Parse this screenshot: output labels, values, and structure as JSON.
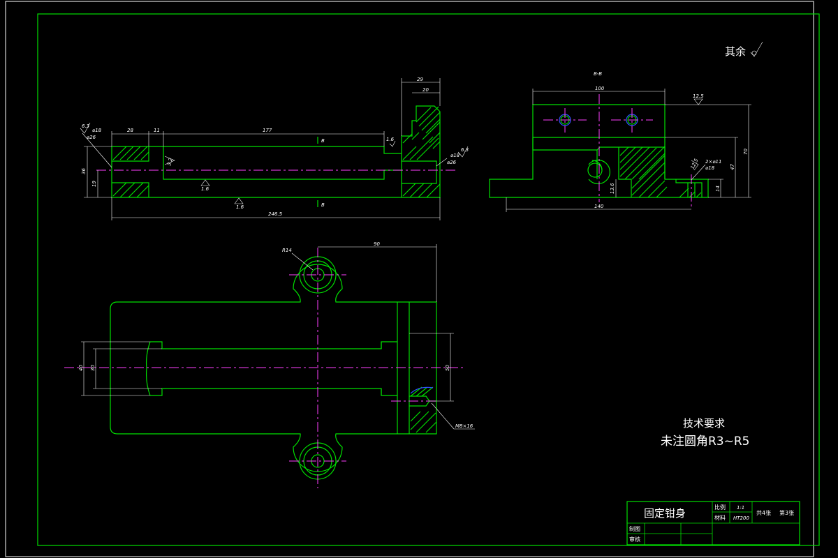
{
  "drawing": {
    "roughness_note": "其余",
    "section_label": "B-B",
    "tech_requirements": {
      "title": "技术要求",
      "note": "未注圆角R3~R5"
    },
    "title_block": {
      "part_name": "固定钳身",
      "scale_label": "比例",
      "scale_value": "1:1",
      "material_label": "材料",
      "material_value": "HT200",
      "sheet_total": "共4张",
      "sheet_number": "第3张",
      "drawn_label": "制图",
      "checked_label": "审核"
    },
    "front_view_dims": {
      "d29": "29",
      "d20": "20",
      "d177": "177",
      "d28": "28",
      "d11": "11",
      "d36": "36",
      "d19": "19",
      "d2465": "246.5",
      "phi18_left": "⌀18",
      "fit_left": "⌀26",
      "phi18_right": "⌀18",
      "fit_right": "⌀26",
      "ra63_left": "6.3",
      "ra63_right": "6.3",
      "ra16_a": "1.6",
      "ra16_b": "1.6",
      "ra16_c": "1.6",
      "ra32": "3.2",
      "section_b_top": "B",
      "section_b_bottom": "B"
    },
    "side_view_dims": {
      "d100": "100",
      "d140": "140",
      "d70": "70",
      "d47": "47",
      "d14": "14",
      "d136": "13.6",
      "ra125": "12.5",
      "holes": "2×⌀11",
      "holes_cb": "⌀18",
      "ra_hole": "12.5"
    },
    "top_view_dims": {
      "r14": "R14",
      "d90": "90",
      "d40": "40",
      "d30": "30",
      "d50": "50",
      "thread": "M8×16"
    }
  }
}
